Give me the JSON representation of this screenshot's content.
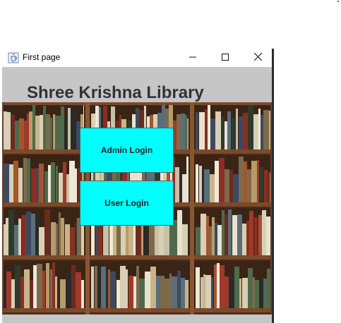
{
  "window": {
    "title": "First page",
    "controls": {
      "minimize": "minimize",
      "maximize": "maximize",
      "close": "close"
    }
  },
  "main": {
    "heading": "Shree Krishna Library",
    "admin_login_label": "Admin Login",
    "user_login_label": "User Login"
  },
  "colors": {
    "button_bg": "#00ffff",
    "heading_text": "#333333",
    "panel_bg": "#c6c6c6",
    "shelf_wood": "#7a4a2a"
  },
  "icons": {
    "app": "java-cup-icon",
    "minimize": "minimize-icon",
    "maximize": "maximize-icon",
    "close": "close-icon"
  }
}
